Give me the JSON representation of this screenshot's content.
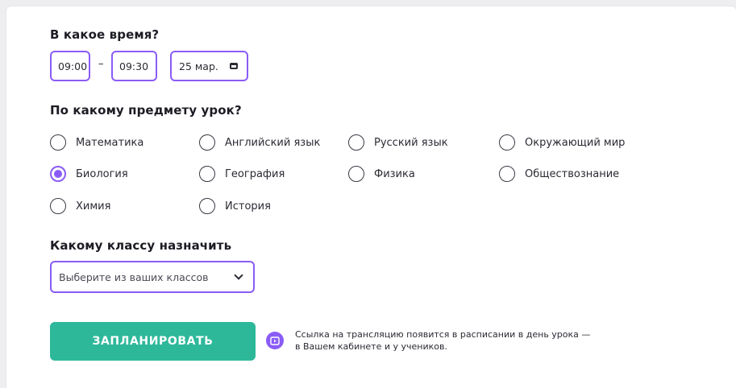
{
  "time_section": {
    "title": "В какое время?",
    "start_time": "09:00",
    "separator": "–",
    "end_time": "09:30",
    "date": "25 мар."
  },
  "subject_section": {
    "title": "По какому предмету урок?",
    "options": [
      {
        "label": "Математика",
        "checked": false
      },
      {
        "label": "Английский язык",
        "checked": false
      },
      {
        "label": "Русский язык",
        "checked": false
      },
      {
        "label": "Окружающий мир",
        "checked": false
      },
      {
        "label": "Биология",
        "checked": true
      },
      {
        "label": "География",
        "checked": false
      },
      {
        "label": "Физика",
        "checked": false
      },
      {
        "label": "Обществознание",
        "checked": false
      },
      {
        "label": "Химия",
        "checked": false
      },
      {
        "label": "История",
        "checked": false
      }
    ]
  },
  "class_section": {
    "title": "Какому классу назначить",
    "select_placeholder": "Выберите из ваших классов"
  },
  "actions": {
    "schedule_button": "ЗАПЛАНИРОВАТЬ",
    "info_line1": "Ссылка на трансляцию появится в расписании в день урока —",
    "info_line2": "в Вашем кабинете и у учеников."
  },
  "colors": {
    "accent": "#8a5cf6",
    "button": "#2db89a",
    "background": "#eeeef1"
  },
  "icons": [
    "calendar-icon",
    "chevron-down-icon",
    "play-screen-icon"
  ]
}
